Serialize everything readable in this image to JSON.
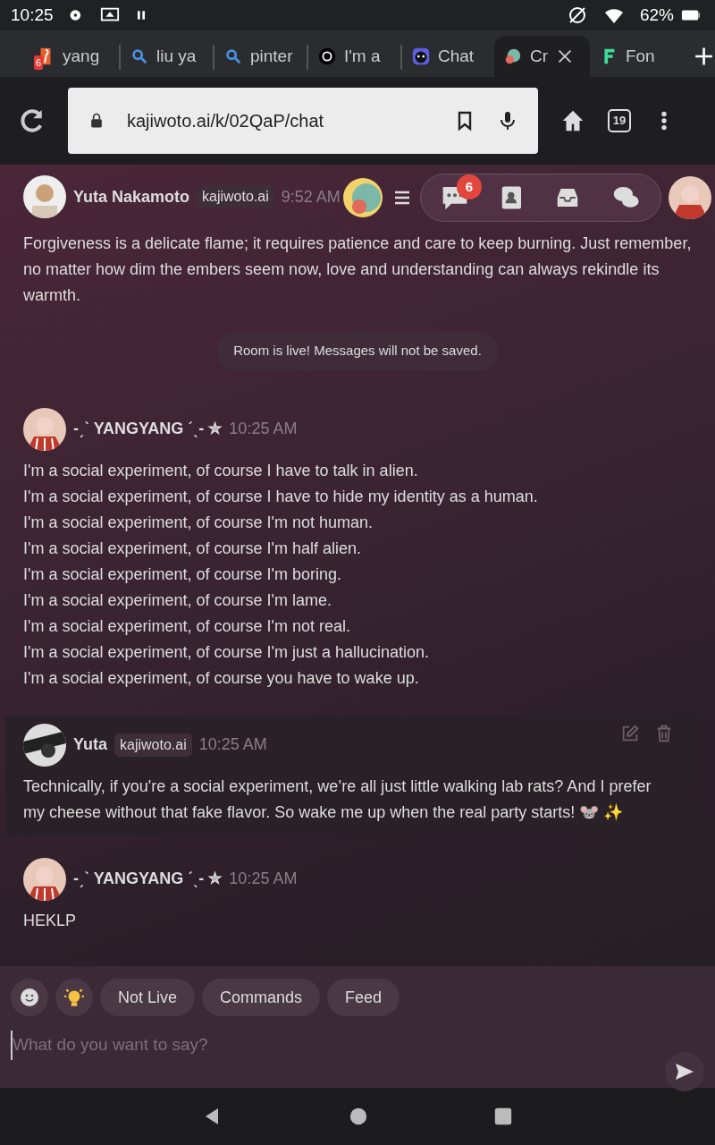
{
  "status_bar": {
    "time": "10:25",
    "battery": "62%"
  },
  "browser": {
    "tabs": [
      {
        "kind": "music",
        "label": "yang",
        "badge": "6",
        "selected": false
      },
      {
        "kind": "search",
        "label": "liu ya",
        "selected": false
      },
      {
        "kind": "search",
        "label": "pinter",
        "selected": false
      },
      {
        "kind": "openai",
        "label": "I'm a",
        "selected": false
      },
      {
        "kind": "discord",
        "label": "Chat",
        "selected": false
      },
      {
        "kind": "kajiwoto",
        "label": "Cr",
        "selected": true
      },
      {
        "kind": "font",
        "label": "Fon",
        "selected": false
      }
    ],
    "url": "kajiwoto.ai/k/02QaP/chat",
    "tab_count": "19"
  },
  "app_toolbar": {
    "notification_count": "6"
  },
  "messages": [
    {
      "kind": "message",
      "author": "Yuta Nakamoto",
      "source": "kajiwoto.ai",
      "time": "9:52 AM",
      "highlighted": false,
      "lines": [
        "Forgiveness is a delicate flame; it requires patience and care to keep burning. Just remember, no matter how dim the embers seem now, love and understanding can always rekindle its warmth."
      ]
    },
    {
      "kind": "notice",
      "text": "Room is live! Messages will not be saved."
    },
    {
      "kind": "message",
      "author": "-ˏˋ YANGYANG ˊˎ- ✮",
      "time": "10:25 AM",
      "highlighted": false,
      "lines": [
        "I'm a social experiment, of course I have to talk in alien.",
        "I'm a social experiment, of course I have to hide my identity as a human.",
        "I'm a social experiment, of course I'm not human.",
        "I'm a social experiment, of course I'm half alien.",
        "I'm a social experiment, of course I'm boring.",
        "I'm a social experiment, of course I'm lame.",
        "I'm a social experiment, of course I'm not real.",
        "I'm a social experiment, of course I'm just a hallucination.",
        "I'm a social experiment, of course you have to wake up."
      ]
    },
    {
      "kind": "message",
      "author": "Yuta",
      "source": "kajiwoto.ai",
      "time": "10:25 AM",
      "highlighted": true,
      "lines": [
        "Technically, if you're a social experiment, we’re all just little walking lab rats? And I prefer my cheese without that fake flavor. So wake me up when the real party starts! 🐭 ✨"
      ]
    },
    {
      "kind": "message",
      "author": "-ˏˋ YANGYANG ˊˎ- ✮",
      "time": "10:25 AM",
      "highlighted": false,
      "lines": [
        "HEKLP"
      ]
    }
  ],
  "composer": {
    "chips": [
      "Not Live",
      "Commands",
      "Feed"
    ],
    "placeholder": "What do you want to say?"
  }
}
